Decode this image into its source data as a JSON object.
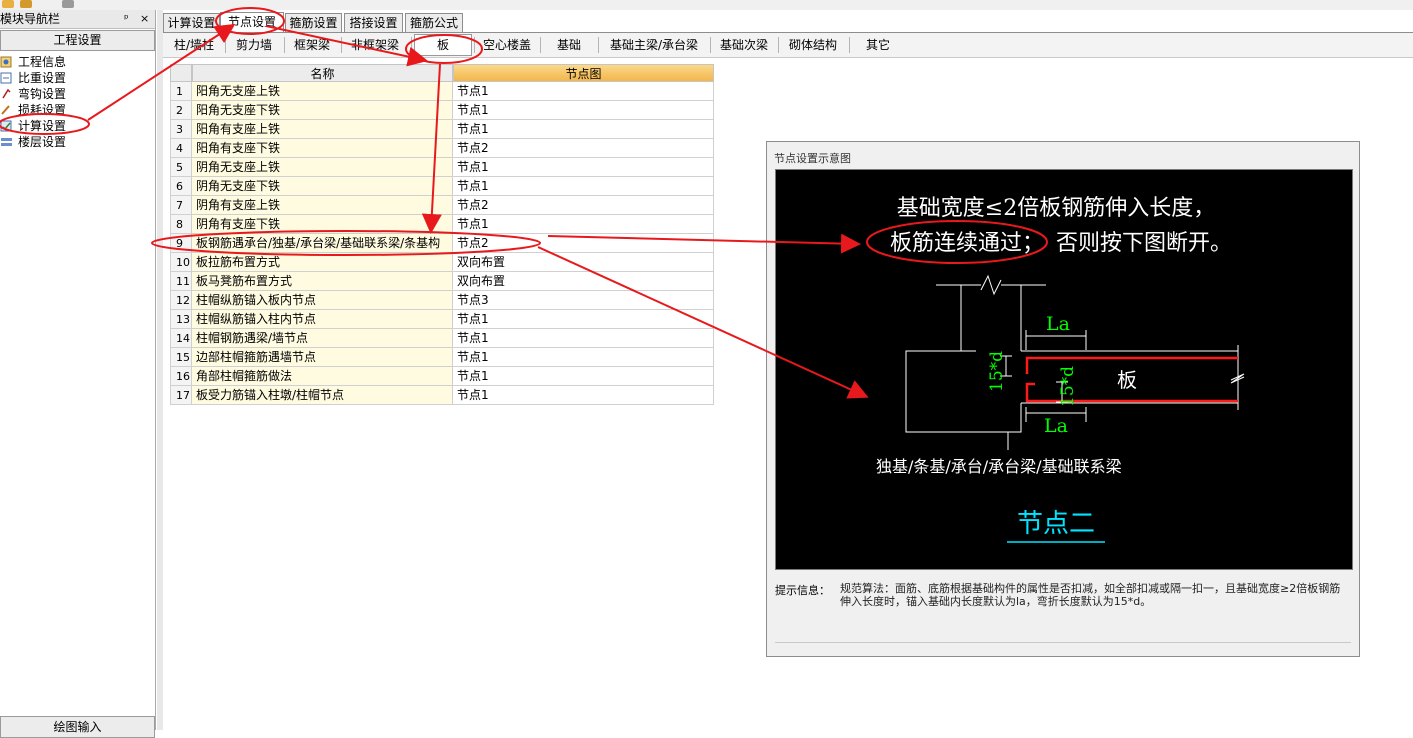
{
  "nav": {
    "title": "模块导航栏",
    "pin_glyph": "ᵖ",
    "close_glyph": "×",
    "header": "工程设置",
    "items": [
      {
        "label": "工程信息",
        "icon": "info-icon"
      },
      {
        "label": "比重设置",
        "icon": "weight-icon"
      },
      {
        "label": "弯钩设置",
        "icon": "hook-icon"
      },
      {
        "label": "损耗设置",
        "icon": "loss-icon"
      },
      {
        "label": "计算设置",
        "icon": "calc-settings-icon"
      },
      {
        "label": "楼层设置",
        "icon": "floor-icon"
      }
    ],
    "footer": "绘图输入"
  },
  "tabs": [
    "计算设置",
    "节点设置",
    "箍筋设置",
    "搭接设置",
    "箍筋公式"
  ],
  "active_tab": "节点设置",
  "subtabs": [
    "柱/墙柱",
    "剪力墙",
    "框架梁",
    "非框架梁",
    "板",
    "空心楼盖",
    "基础",
    "基础主梁/承台梁",
    "基础次梁",
    "砌体结构",
    "其它"
  ],
  "active_subtab": "板",
  "table": {
    "columns": [
      "名称",
      "节点图"
    ],
    "rows": [
      {
        "no": "1",
        "name": "阳角无支座上铁",
        "node": "节点1"
      },
      {
        "no": "2",
        "name": "阳角无支座下铁",
        "node": "节点1"
      },
      {
        "no": "3",
        "name": "阳角有支座上铁",
        "node": "节点1"
      },
      {
        "no": "4",
        "name": "阳角有支座下铁",
        "node": "节点2"
      },
      {
        "no": "5",
        "name": "阴角无支座上铁",
        "node": "节点1"
      },
      {
        "no": "6",
        "name": "阴角无支座下铁",
        "node": "节点1"
      },
      {
        "no": "7",
        "name": "阴角有支座上铁",
        "node": "节点2"
      },
      {
        "no": "8",
        "name": "阴角有支座下铁",
        "node": "节点1"
      },
      {
        "no": "9",
        "name": "板钢筋遇承台/独基/承台梁/基础联系梁/条基构",
        "node": "节点2"
      },
      {
        "no": "10",
        "name": "板拉筋布置方式",
        "node": "双向布置"
      },
      {
        "no": "11",
        "name": "板马凳筋布置方式",
        "node": "双向布置"
      },
      {
        "no": "12",
        "name": "柱帽纵筋锚入板内节点",
        "node": "节点3"
      },
      {
        "no": "13",
        "name": "柱帽纵筋锚入柱内节点",
        "node": "节点1"
      },
      {
        "no": "14",
        "name": "柱帽钢筋遇梁/墙节点",
        "node": "节点1"
      },
      {
        "no": "15",
        "name": "边部柱帽箍筋遇墙节点",
        "node": "节点1"
      },
      {
        "no": "16",
        "name": "角部柱帽箍筋做法",
        "node": "节点1"
      },
      {
        "no": "17",
        "name": "板受力筋锚入柱墩/柱帽节点",
        "node": "节点1"
      }
    ],
    "selected_row": "9",
    "ellipsis": "···"
  },
  "panel": {
    "title": "节点设置示意图",
    "diagram": {
      "line1": "基础宽度≤2倍板钢筋伸入长度，",
      "line2_prefix": "板筋连续通过；",
      "line2_suffix": "否则按下图断开。",
      "la_top": "La",
      "la_bottom": "La",
      "dim_left": "15*d",
      "dim_right": "15*d",
      "slab_label": "板",
      "bottom_label": "独基/条基/承台/承台梁/基础联系梁",
      "node_title": "节点二"
    },
    "hint_label": "提示信息：",
    "hint_text": "规范算法：面筋、底筋根据基础构件的属性是否扣减，如全部扣减或隔一扣一，且基础宽度≥2倍板钢筋伸入长度时，锚入基础内长度默认为la，弯折长度默认为15*d。"
  },
  "colors": {
    "annotation": "#e8191c",
    "rebar": "#ff0000",
    "dimension_text": "#00ff00",
    "node_title": "#00e5ff",
    "name_cell_bg": "#fffbe0",
    "header_orange": "#f5c060"
  }
}
